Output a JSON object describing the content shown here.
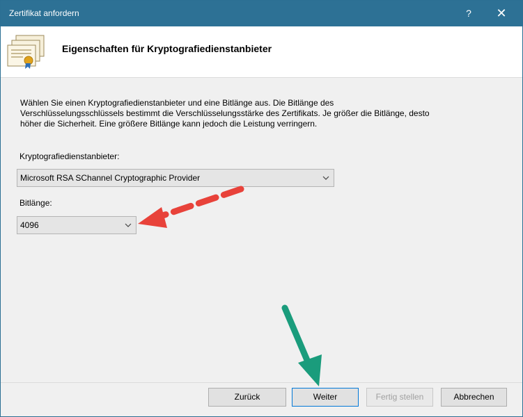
{
  "window": {
    "title": "Zertifikat anfordern",
    "help_label": "?",
    "close_label": "✕"
  },
  "header": {
    "title": "Eigenschaften für Kryptografiedienstanbieter",
    "icon": "certificate-icon"
  },
  "description": [
    "Wählen Sie einen Kryptografiedienstanbieter und eine Bitlänge aus. Die Bitlänge des",
    "Verschlüsselungsschlüssels bestimmt die Verschlüsselungsstärke des Zertifikats. Je größer die Bitlänge, desto",
    "höher die Sicherheit. Eine größere Bitlänge kann jedoch die Leistung verringern."
  ],
  "provider": {
    "label": "Kryptografiedienstanbieter:",
    "value": "Microsoft RSA SChannel Cryptographic Provider"
  },
  "bitlength": {
    "label": "Bitlänge:",
    "value": "4096"
  },
  "buttons": {
    "back": "Zurück",
    "next": "Weiter",
    "finish": "Fertig stellen",
    "cancel": "Abbrechen"
  },
  "colors": {
    "titlebar": "#2d7195",
    "annotation_red": "#e8423a",
    "annotation_green": "#1a9c7c"
  }
}
